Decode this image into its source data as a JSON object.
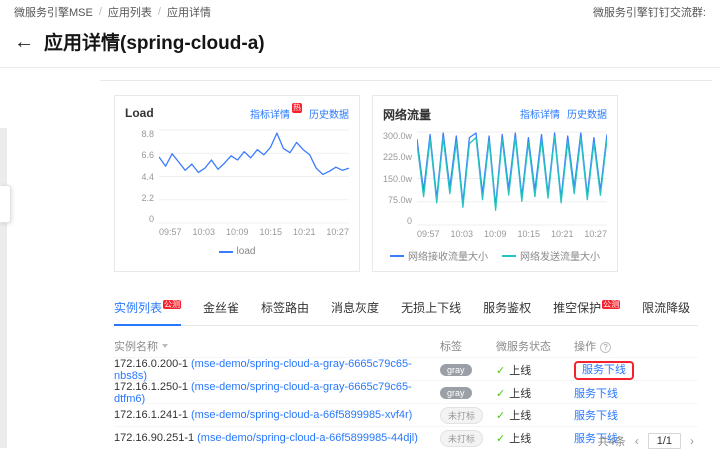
{
  "topbar": {
    "breadcrumb": [
      "微服务引擎MSE",
      "应用列表",
      "应用详情"
    ],
    "right_link": "微服务引擎钉钉交流群:"
  },
  "page": {
    "back_arrow": "←",
    "title": "应用详情(spring-cloud-a)"
  },
  "links": {
    "metric_detail": "指标详情",
    "history": "历史数据",
    "hot_badge": "热"
  },
  "charts": {
    "load": {
      "title": "Load",
      "ymax": 8.8,
      "y_ticks": [
        "8.8",
        "6.6",
        "4.4",
        "2.2",
        "0"
      ],
      "x_ticks": [
        "09:57",
        "10:03",
        "10:09",
        "10:15",
        "10:21",
        "10:27"
      ],
      "series": [
        {
          "name": "load",
          "color": "#3b7bff",
          "values": [
            6.3,
            5.4,
            6.6,
            5.8,
            5.0,
            5.6,
            4.8,
            5.2,
            6.0,
            5.1,
            5.7,
            6.4,
            6.0,
            6.8,
            6.2,
            7.0,
            6.5,
            7.2,
            8.6,
            7.1,
            6.7,
            7.7,
            7.0,
            6.5,
            5.2,
            4.6,
            4.9,
            5.3,
            5.0,
            5.2
          ]
        }
      ]
    },
    "network": {
      "title": "网络流量",
      "ymax": 300,
      "y_ticks": [
        "300.0w",
        "225.0w",
        "150.0w",
        "75.0w",
        "0"
      ],
      "x_ticks": [
        "09:57",
        "10:03",
        "10:09",
        "10:15",
        "10:21",
        "10:27"
      ],
      "series": [
        {
          "name": "网络接收流量大小",
          "color": "#3b7bff",
          "values": [
            280,
            110,
            295,
            85,
            300,
            120,
            290,
            70,
            285,
            300,
            100,
            290,
            60,
            295,
            115,
            300,
            90,
            285,
            110,
            295,
            100,
            300,
            85,
            290,
            120,
            300,
            95,
            285,
            110,
            295
          ]
        },
        {
          "name": "网络发送流量大小",
          "color": "#27c2c2",
          "values": [
            265,
            90,
            280,
            70,
            285,
            100,
            270,
            55,
            265,
            285,
            80,
            275,
            45,
            280,
            95,
            285,
            75,
            268,
            90,
            278,
            85,
            288,
            70,
            272,
            100,
            285,
            80,
            268,
            95,
            280
          ]
        }
      ]
    }
  },
  "tabs": [
    {
      "label": "实例列表",
      "badge": "公测"
    },
    {
      "label": "金丝雀"
    },
    {
      "label": "标签路由"
    },
    {
      "label": "消息灰度"
    },
    {
      "label": "无损上下线"
    },
    {
      "label": "服务鉴权"
    },
    {
      "label": "推空保护",
      "badge": "公测"
    },
    {
      "label": "限流降级"
    }
  ],
  "table": {
    "headers": {
      "name": "实例名称",
      "tag": "标签",
      "status": "微服务状态",
      "action": "操作"
    },
    "rows": [
      {
        "ip": "172.16.0.200-1",
        "pod": "(mse-demo/spring-cloud-a-gray-6665c79c65-nbs8s)",
        "tag": "gray",
        "status": "上线",
        "action": "服务下线"
      },
      {
        "ip": "172.16.1.250-1",
        "pod": "(mse-demo/spring-cloud-a-gray-6665c79c65-dtfm6)",
        "tag": "gray",
        "status": "上线",
        "action": "服务下线"
      },
      {
        "ip": "172.16.1.241-1",
        "pod": "(mse-demo/spring-cloud-a-66f5899985-xvf4r)",
        "tag": "未打标",
        "status": "上线",
        "action": "服务下线"
      },
      {
        "ip": "172.16.90.251-1",
        "pod": "(mse-demo/spring-cloud-a-66f5899985-44djl)",
        "tag": "未打标",
        "status": "上线",
        "action": "服务下线"
      }
    ]
  },
  "icons": {
    "check": "✓"
  },
  "pagination": {
    "total": "共4条",
    "prev": "‹",
    "current": "1/1",
    "next": "›"
  },
  "colors": {
    "accent": "#2878ff",
    "danger": "#f5222d",
    "success": "#52c41a",
    "chart_blue": "#3b7bff",
    "chart_teal": "#27c2c2"
  }
}
